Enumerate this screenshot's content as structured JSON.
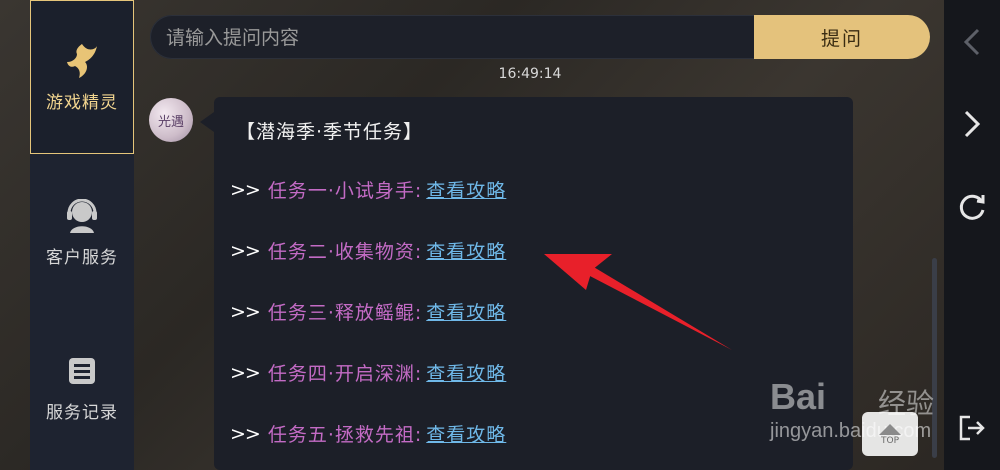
{
  "sidebar": {
    "items": [
      {
        "label": "游戏精灵",
        "icon": "sprite-icon",
        "active": true
      },
      {
        "label": "客户服务",
        "icon": "customer-service-icon",
        "active": false
      },
      {
        "label": "服务记录",
        "icon": "record-list-icon",
        "active": false
      }
    ]
  },
  "search": {
    "placeholder": "请输入提问内容",
    "value": "",
    "ask_label": "提问"
  },
  "chat": {
    "timestamp": "16:49:14",
    "avatar_text": "光遇",
    "message": {
      "title": "【潜海季·季节任务】",
      "tasks": [
        {
          "prefix": ">>",
          "name": "任务一·小试身手:",
          "link": "查看攻略"
        },
        {
          "prefix": ">>",
          "name": "任务二·收集物资:",
          "link": "查看攻略"
        },
        {
          "prefix": ">>",
          "name": "任务三·释放鳐鲲:",
          "link": "查看攻略"
        },
        {
          "prefix": ">>",
          "name": "任务四·开启深渊:",
          "link": "查看攻略"
        },
        {
          "prefix": ">>",
          "name": "任务五·拯救先祖:",
          "link": "查看攻略"
        }
      ]
    }
  },
  "rightbar": {
    "buttons": [
      "back-icon",
      "forward-icon",
      "refresh-icon",
      "exit-icon"
    ]
  },
  "top_button": {
    "label": "TOP"
  },
  "watermark": {
    "brand": "Bai",
    "brand_cn": "经验",
    "url": "jingyan.baidu.com"
  },
  "colors": {
    "accent": "#e4c27c",
    "task_name": "#c36bc5",
    "link": "#6fb8e8",
    "annotation": "#e8202a"
  }
}
